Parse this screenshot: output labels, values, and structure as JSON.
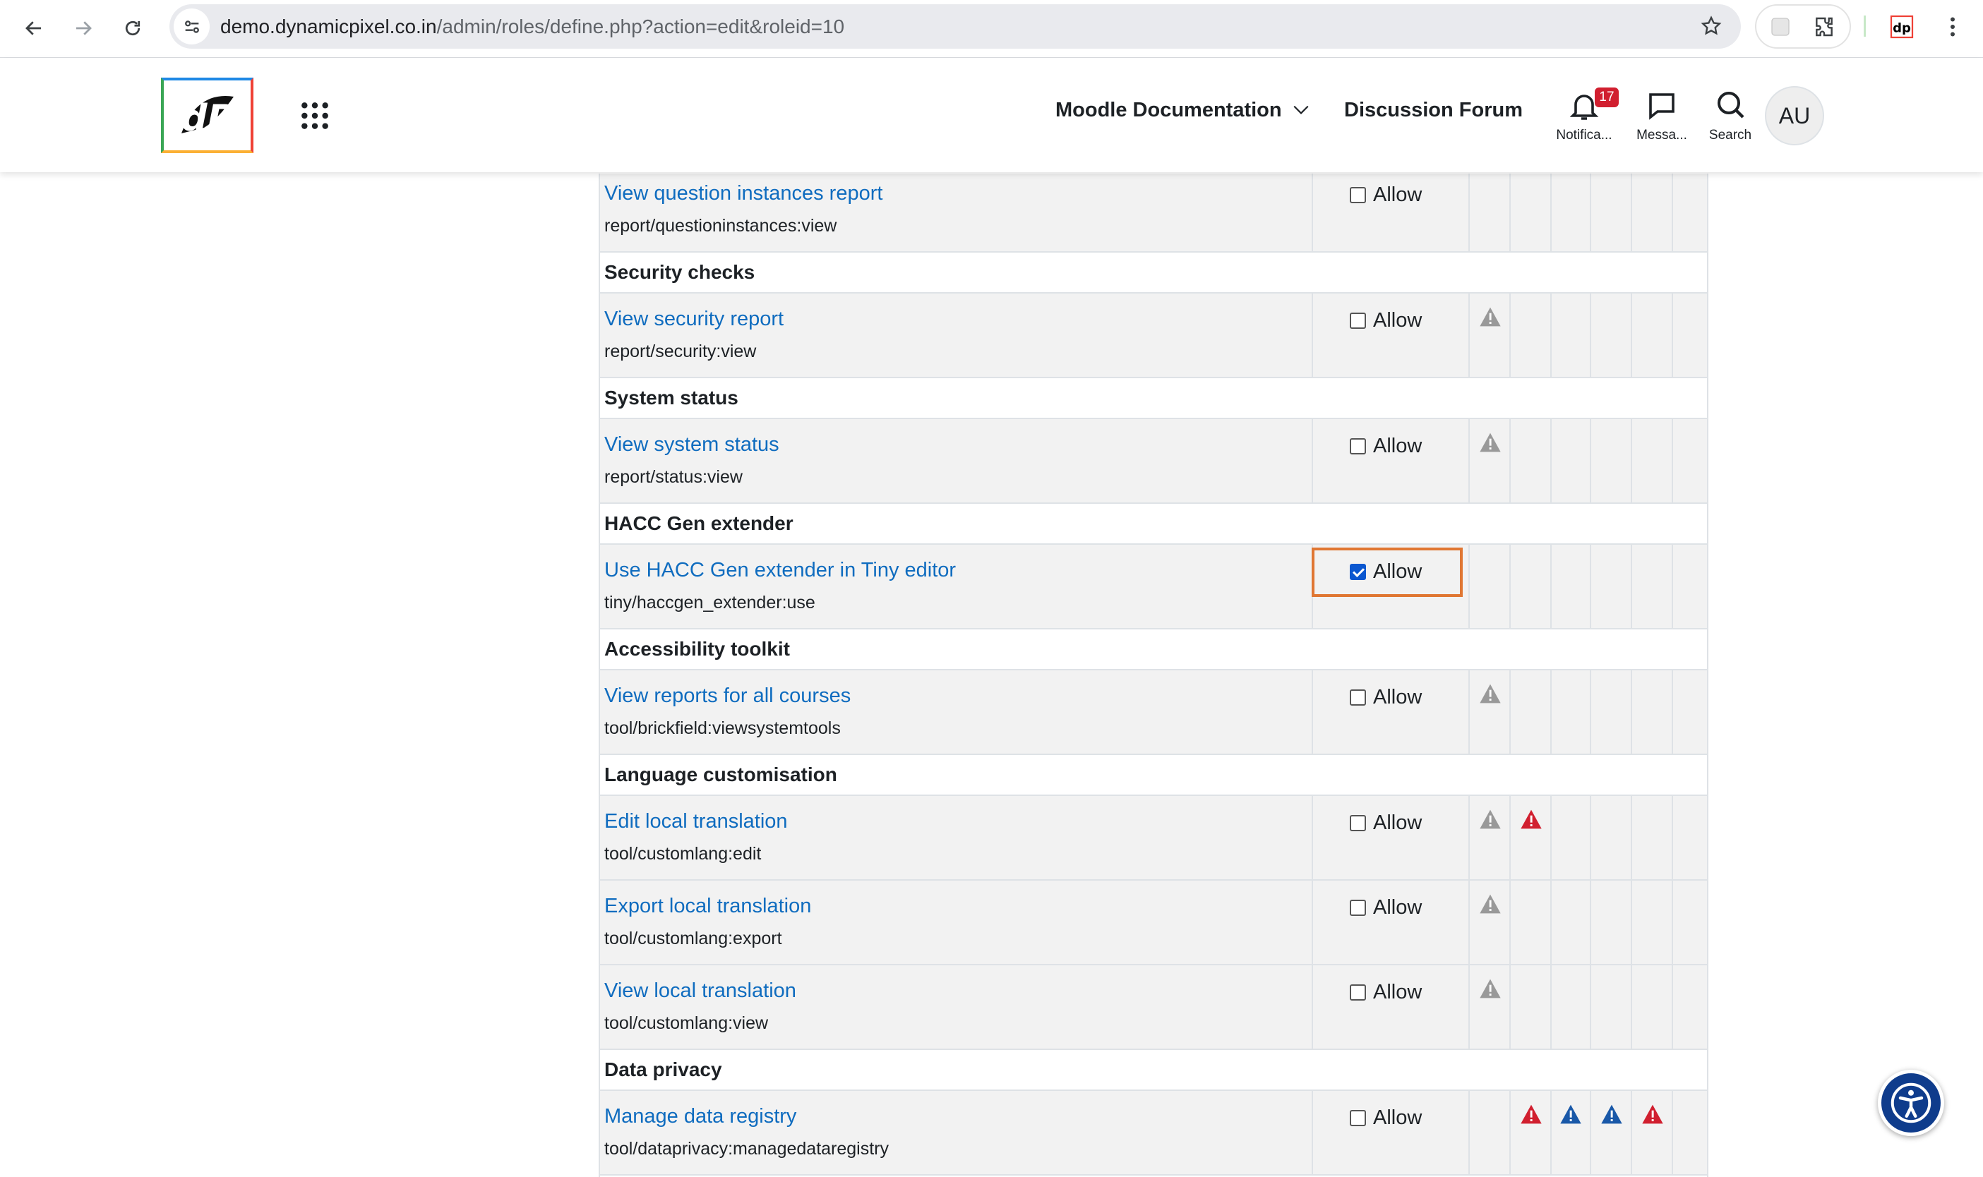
{
  "browser": {
    "url_host": "demo.dynamicpixel.co.in",
    "url_path": "/admin/roles/define.php?action=edit&roleid=10"
  },
  "navbar": {
    "logo_text": "dP",
    "links": {
      "docs": "Moodle Documentation",
      "forum": "Discussion Forum"
    },
    "notifications": {
      "label": "Notifica...",
      "count": "17"
    },
    "messages": {
      "label": "Messa..."
    },
    "search": {
      "label": "Search"
    },
    "avatar": "AU"
  },
  "table": {
    "allow_label": "Allow",
    "rows": [
      {
        "type": "capability",
        "name": "View question instances report",
        "id": "report/questioninstances:view",
        "checked": false,
        "risks": []
      },
      {
        "type": "group",
        "title": "Security checks"
      },
      {
        "type": "capability",
        "name": "View security report",
        "id": "report/security:view",
        "checked": false,
        "risks": [
          "config-gray"
        ]
      },
      {
        "type": "group",
        "title": "System status"
      },
      {
        "type": "capability",
        "name": "View system status",
        "id": "report/status:view",
        "checked": false,
        "risks": [
          "config-gray"
        ]
      },
      {
        "type": "group",
        "title": "HACC Gen extender"
      },
      {
        "type": "capability",
        "name": "Use HACC Gen extender in Tiny editor",
        "id": "tiny/haccgen_extender:use",
        "checked": true,
        "highlighted": true,
        "risks": []
      },
      {
        "type": "group",
        "title": "Accessibility toolkit"
      },
      {
        "type": "capability",
        "name": "View reports for all courses",
        "id": "tool/brickfield:viewsystemtools",
        "checked": false,
        "risks": [
          "config-gray"
        ]
      },
      {
        "type": "group",
        "title": "Language customisation"
      },
      {
        "type": "capability",
        "name": "Edit local translation",
        "id": "tool/customlang:edit",
        "checked": false,
        "risks": [
          "config-gray",
          "xss-red"
        ]
      },
      {
        "type": "capability",
        "name": "Export local translation",
        "id": "tool/customlang:export",
        "checked": false,
        "risks": [
          "config-gray"
        ]
      },
      {
        "type": "capability",
        "name": "View local translation",
        "id": "tool/customlang:view",
        "checked": false,
        "risks": [
          "config-gray"
        ]
      },
      {
        "type": "group",
        "title": "Data privacy"
      },
      {
        "type": "capability",
        "name": "Manage data registry",
        "id": "tool/dataprivacy:managedataregistry",
        "checked": false,
        "risks": [
          "",
          "xss-red",
          "personal-blue",
          "spam-blue",
          "dataloss-red"
        ]
      }
    ]
  },
  "colors": {
    "link": "#0f6cbf",
    "highlight_border": "#e07733",
    "risk_gray": "#999999",
    "risk_red": "#d11f2f",
    "risk_blue": "#1958a8",
    "checkbox_checked": "#0b57d0"
  }
}
